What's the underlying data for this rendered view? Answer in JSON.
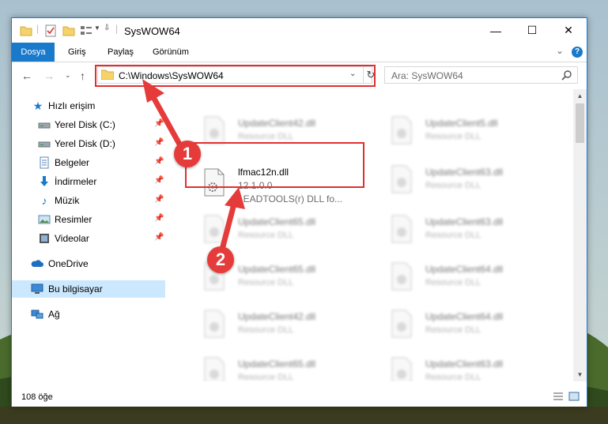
{
  "window": {
    "title": "SysWOW64",
    "minimize": "—",
    "maximize": "☐",
    "close": "✕"
  },
  "ribbon": {
    "tabs": [
      "Dosya",
      "Giriş",
      "Paylaş",
      "Görünüm"
    ],
    "help": "?"
  },
  "address": {
    "path": "C:\\Windows\\SysWOW64"
  },
  "search": {
    "placeholder": "Ara: SysWOW64"
  },
  "sidebar": {
    "items": [
      {
        "label": "Hızlı erişim",
        "icon": "star-icon"
      },
      {
        "label": "Yerel Disk (C:)",
        "icon": "drive-icon",
        "pinned": true
      },
      {
        "label": "Yerel Disk (D:)",
        "icon": "drive-icon",
        "pinned": true
      },
      {
        "label": "Belgeler",
        "icon": "documents-icon",
        "pinned": true
      },
      {
        "label": "İndirmeler",
        "icon": "download-icon",
        "pinned": true
      },
      {
        "label": "Müzik",
        "icon": "music-icon",
        "pinned": true
      },
      {
        "label": "Resimler",
        "icon": "pictures-icon",
        "pinned": true
      },
      {
        "label": "Videolar",
        "icon": "videos-icon",
        "pinned": true
      },
      {
        "label": "OneDrive",
        "icon": "cloud-icon"
      },
      {
        "label": "Bu bilgisayar",
        "icon": "computer-icon",
        "selected": true
      },
      {
        "label": "Ağ",
        "icon": "network-icon"
      }
    ]
  },
  "files": {
    "blurred": [
      {
        "name": "UpdateClient42.dll",
        "desc": "Resource DLL"
      },
      {
        "name": "UpdateClient5.dll",
        "desc": "Resource DLL"
      },
      {
        "name": "UpdateClient63.dll",
        "desc": "Resource DLL"
      },
      {
        "name": "UpdateClient65.dll",
        "desc": "Resource DLL"
      },
      {
        "name": "UpdateClient63.dll",
        "desc": "Resource DLL"
      },
      {
        "name": "UpdateClient64.dll",
        "desc": "Resource DLL"
      },
      {
        "name": "UpdateClient65.dll",
        "desc": "Resource DLL"
      },
      {
        "name": "UpdateClient42.dll",
        "desc": "Resource DLL"
      },
      {
        "name": "UpdateClient64.dll",
        "desc": "Resource DLL"
      },
      {
        "name": "UpdateClient65.dll",
        "desc": "Resource DLL"
      },
      {
        "name": "UpdateClient63.dll",
        "desc": "Resource DLL"
      }
    ],
    "focus": {
      "name": "lfmac12n.dll",
      "version": "12.1.0.0",
      "description": "LEADTOOLS(r) DLL fo..."
    }
  },
  "status": {
    "count": "108 öğe"
  },
  "annotations": {
    "badge1": "1",
    "badge2": "2",
    "color": "#e03030"
  }
}
